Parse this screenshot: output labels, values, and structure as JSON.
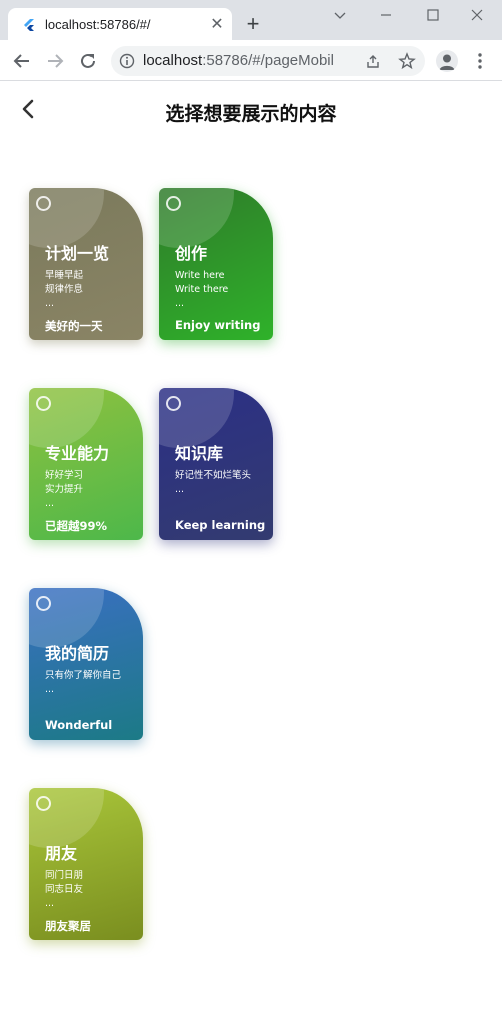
{
  "browser": {
    "tab_title": "localhost:58786/#/",
    "tab_close": "✕",
    "new_tab": "+",
    "url_host": "localhost",
    "url_rest": ":58786/#/pageMobil...",
    "icons": [
      "flutter-favicon",
      "chevron-down-icon",
      "minimize-icon",
      "maximize-icon",
      "close-icon",
      "back-icon",
      "forward-icon",
      "reload-icon",
      "info-icon",
      "share-icon",
      "star-icon",
      "profile-icon",
      "menu-icon"
    ]
  },
  "header": {
    "title": "选择想要展示的内容"
  },
  "cards": [
    {
      "title": "计划一览",
      "lines": [
        "早睡早起",
        "规律作息",
        "..."
      ],
      "footer": "美好的一天",
      "color": "#7b7a5c"
    },
    {
      "title": "创作",
      "lines": [
        "Write here",
        "Write there",
        "..."
      ],
      "footer": "Enjoy writing",
      "color": "#2fa82a"
    },
    {
      "title": "专业能力",
      "lines": [
        "好好学习",
        "实力提升",
        "..."
      ],
      "footer": "已超越99%",
      "color": "#6dbb45"
    },
    {
      "title": "知识库",
      "lines": [
        "好记性不如烂笔头",
        "..."
      ],
      "footer": "Keep learning",
      "color": "#2b2f86"
    },
    {
      "title": "我的简历",
      "lines": [
        "只有你了解你自己",
        "..."
      ],
      "footer": "Wonderful",
      "color": "#2a73a6"
    },
    {
      "title": "朋友",
      "lines": [
        "同门日朋",
        "同志日友",
        "..."
      ],
      "footer": "朋友聚居",
      "color": "#94ad2c"
    }
  ]
}
